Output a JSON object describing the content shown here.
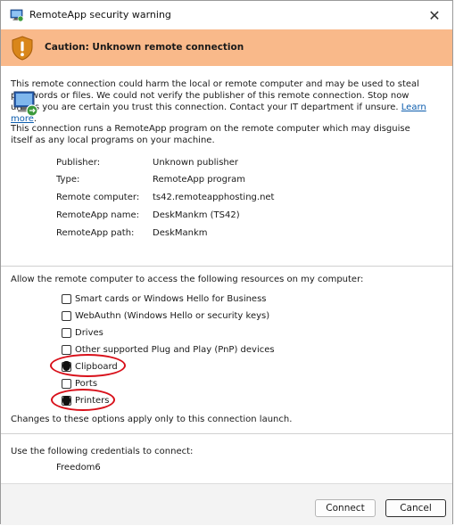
{
  "window": {
    "title": "RemoteApp security warning",
    "close_symbol": "✕"
  },
  "banner": {
    "text": "Caution: Unknown remote connection",
    "color": "#f9b98a"
  },
  "warning": {
    "text": "This remote connection could harm the local or remote computer and may be used to steal passwords or files. We could not verify the publisher of this remote connection. Stop now unless you are certain you trust this connection. Contact your IT department if unsure. ",
    "link": "Learn more",
    "link_suffix": "."
  },
  "disguise_text": "This connection runs a RemoteApp program on the remote computer which may disguise itself as any local programs on your machine.",
  "properties": [
    {
      "label": "Publisher:",
      "value": "Unknown publisher"
    },
    {
      "label": "Type:",
      "value": "RemoteApp program"
    },
    {
      "label": "Remote computer:",
      "value": "ts42.remoteapphosting.net"
    },
    {
      "label": "RemoteApp name:",
      "value": "DeskMankm (TS42)"
    },
    {
      "label": "RemoteApp path:",
      "value": "DeskMankm"
    }
  ],
  "resources": {
    "heading": "Allow the remote computer to access the following resources on my computer:",
    "options": [
      {
        "label": "Smart cards or Windows Hello for Business",
        "checked": false
      },
      {
        "label": "WebAuthn (Windows Hello or security keys)",
        "checked": false
      },
      {
        "label": "Drives",
        "checked": false
      },
      {
        "label": "Other supported Plug and Play (PnP) devices",
        "checked": false
      },
      {
        "label": "Clipboard",
        "checked": false
      },
      {
        "label": "Ports",
        "checked": false
      },
      {
        "label": "Printers",
        "checked": false
      }
    ],
    "note": "Changes to these options apply only to this connection launch."
  },
  "credentials": {
    "heading": "Use the following credentials to connect:",
    "username": "Freedom6"
  },
  "buttons": {
    "connect": "Connect",
    "cancel": "Cancel"
  },
  "annotation_color": "#d8101a"
}
